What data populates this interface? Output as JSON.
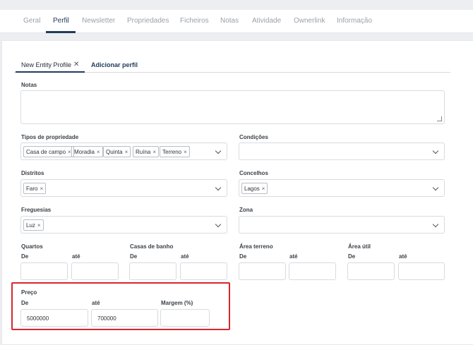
{
  "tabs": [
    "Geral",
    "Perfil",
    "Newsletter",
    "Propriedades",
    "Ficheiros",
    "Notas",
    "Atividade",
    "Ownerlink",
    "Informação"
  ],
  "profile_tabs": {
    "active": "New Entity Profile",
    "close_glyph": "✕",
    "add": "Adicionar perfil"
  },
  "notas": {
    "label": "Notas",
    "value": ""
  },
  "tipos": {
    "label": "Tipos de propriedade",
    "chips": [
      "Casa de campo",
      "Moradia",
      "Quinta",
      "Ruína",
      "Terreno"
    ]
  },
  "condicoes": {
    "label": "Condições"
  },
  "distritos": {
    "label": "Distritos",
    "chips": [
      "Faro"
    ]
  },
  "concelhos": {
    "label": "Concelhos",
    "chips": [
      "Lagos"
    ]
  },
  "freguesias": {
    "label": "Freguesias",
    "chips": [
      "Luz"
    ]
  },
  "zona": {
    "label": "Zona"
  },
  "ranges": {
    "de": "De",
    "ate": "até",
    "quartos": "Quartos",
    "casas_banho": "Casas de banho",
    "area_terreno": "Área terreno",
    "area_util": "Área útil"
  },
  "preco": {
    "label": "Preço",
    "de": "De",
    "ate": "até",
    "margem": "Margem (%)",
    "de_value": "5000000",
    "ate_value": "700000",
    "margem_value": ""
  },
  "chip_remove_glyph": "×",
  "colors": {
    "accent": "#243b5c",
    "highlight": "#d7262c"
  }
}
